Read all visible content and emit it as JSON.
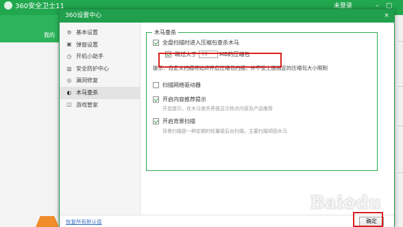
{
  "app": {
    "title": "360安全卫士11",
    "user": "未登录",
    "nav_label": "我的"
  },
  "dialog": {
    "title": "360设置中心",
    "close_label": "×"
  },
  "sidebar": {
    "items": [
      {
        "label": "基本设置",
        "icon": "gear-icon",
        "glyph": "⚙"
      },
      {
        "label": "弹窗设置",
        "icon": "window-icon",
        "glyph": "▣"
      },
      {
        "label": "开机小助手",
        "icon": "clock-icon",
        "glyph": "◷"
      },
      {
        "label": "安全防护中心",
        "icon": "shield-grid-icon",
        "glyph": "▥"
      },
      {
        "label": "漏洞修复",
        "icon": "patch-icon",
        "glyph": "◎"
      },
      {
        "label": "木马查杀",
        "icon": "trojan-scan-icon",
        "glyph": "◐",
        "active": true
      },
      {
        "label": "游戏管家",
        "icon": "gamepad-icon",
        "glyph": "◫"
      }
    ]
  },
  "section": {
    "title": "木马查杀",
    "scan_archives": {
      "label": "全盘扫描时进入压缩包查杀木马",
      "checked": true
    },
    "skip_large": {
      "prefix": "跳过大于",
      "value": "50",
      "suffix": "MB的压缩包",
      "checked": true
    },
    "tip": "提示：自定义扫描将始终开启压缩包扫描，并不受上面指定的压缩包大小限制",
    "scan_drivers": {
      "label": "扫描网络驱动器",
      "checked": false
    },
    "recommend": {
      "label": "开启内容推荐提示",
      "checked": true,
      "desc": "开启提示，在木马查杀界面显示热点内容及产品推荐"
    },
    "background_scan": {
      "label": "开启背景扫描",
      "checked": true,
      "desc": "背景扫描是一种定期的轻量级后台扫描，主要扫描顽固木马"
    }
  },
  "footer": {
    "restore_label": "恢复所有默认值",
    "ok_label": "确定"
  },
  "watermark": {
    "text": "Bai",
    "text2": "du"
  },
  "colors": {
    "brand_green": "#20a04c",
    "highlight_red": "#d81e1e",
    "link_blue": "#3a6fc0"
  }
}
